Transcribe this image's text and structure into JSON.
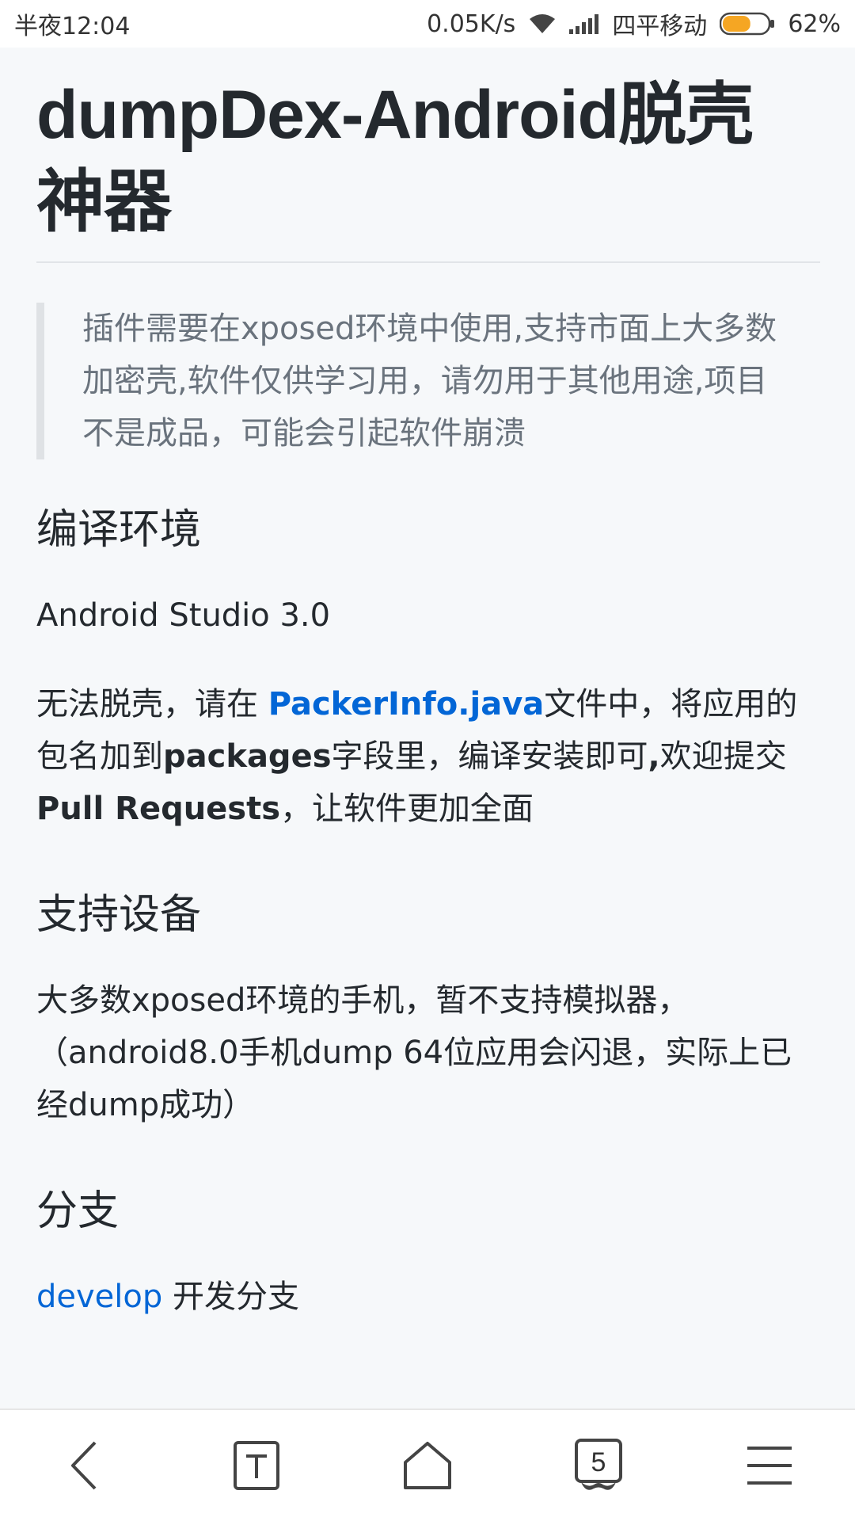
{
  "status_bar": {
    "time": "半夜12:04",
    "speed": "0.05K/s",
    "carrier": "四平移动",
    "battery": "62%",
    "battery_level": 0.62,
    "battery_color": "#f5a623"
  },
  "article": {
    "title": "dumpDex-Android脱壳神器",
    "notice": "插件需要在xposed环境中使用,支持市面上大多数加密壳,软件仅供学习用，请勿用于其他用途,项目不是成品，可能会引起软件崩溃",
    "sections": {
      "build": {
        "heading": "编译环境",
        "env": "Android Studio 3.0",
        "instructions": {
          "part1": "无法脱壳，请在 ",
          "link": "PackerInfo.java",
          "part2": "文件中，将应用的包名加到",
          "bold1": "packages",
          "part3": "字段里，编译安装即可",
          "bold2": ",",
          "part4": "欢迎提交",
          "bold3": "Pull Requests",
          "part5": "，让软件更加全面"
        }
      },
      "devices": {
        "heading": "支持设备",
        "text": "大多数xposed环境的手机，暂不支持模拟器，（android8.0手机dump 64位应用会闪退，实际上已经dump成功）"
      },
      "branches": {
        "heading": "分支",
        "link": "develop",
        "text": " 开发分支"
      }
    }
  },
  "bottom_nav": {
    "tabs_count": "5",
    "icons": [
      "back-icon",
      "text-mode-icon",
      "home-icon",
      "tabs-icon",
      "menu-icon"
    ]
  },
  "colors": {
    "link": "#0366d6",
    "text": "#24292e",
    "quote_text": "#6a737d"
  }
}
